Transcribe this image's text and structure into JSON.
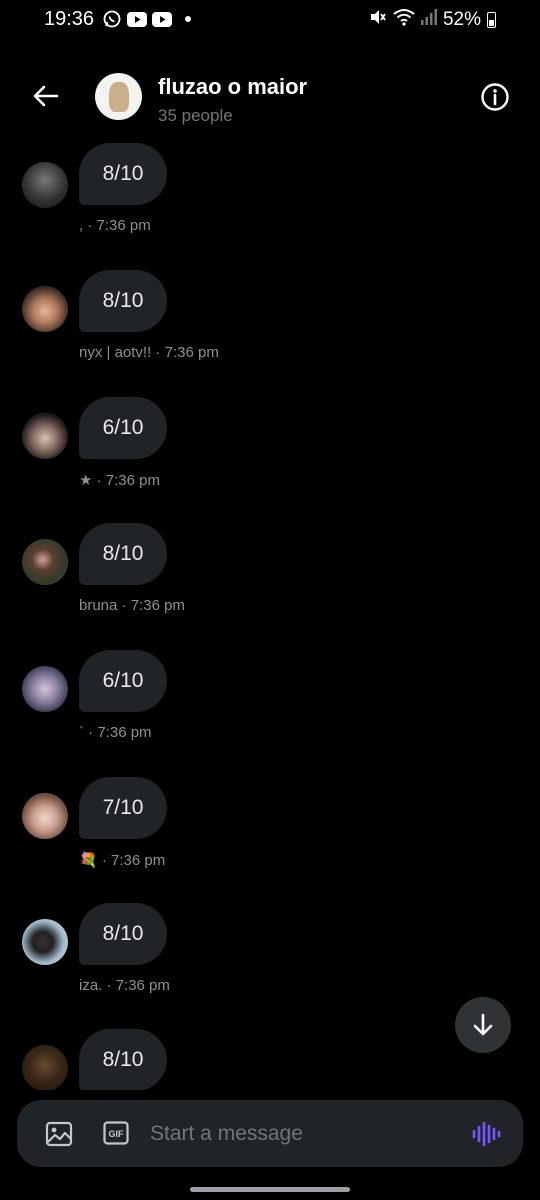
{
  "status_bar": {
    "time": "19:36",
    "battery": "52%",
    "app_icons": [
      "whatsapp-icon",
      "youtube-icon",
      "youtube-icon"
    ]
  },
  "header": {
    "title": "fluzao o maior",
    "subtitle": "35 people"
  },
  "messages": [
    {
      "text": "8/10",
      "sender": ",",
      "time": "7:36 pm"
    },
    {
      "text": "8/10",
      "sender": "nyx | aotv!!",
      "time": "7:36 pm"
    },
    {
      "text": "6/10",
      "sender": "★",
      "time": "7:36 pm"
    },
    {
      "text": "8/10",
      "sender": "bruna",
      "time": "7:36 pm"
    },
    {
      "text": "6/10",
      "sender": "`",
      "time": "7:36 pm"
    },
    {
      "text": "7/10",
      "sender": "💐",
      "time": "7:36 pm"
    },
    {
      "text": "8/10",
      "sender": "iza.",
      "time": "7:36 pm"
    },
    {
      "text": "8/10",
      "sender": "",
      "time": ""
    }
  ],
  "composer": {
    "placeholder": "Start a message"
  },
  "colors": {
    "background": "#000000",
    "bubble": "#202327",
    "muted_text": "#71767b",
    "voice_accent": "#7856ff"
  }
}
